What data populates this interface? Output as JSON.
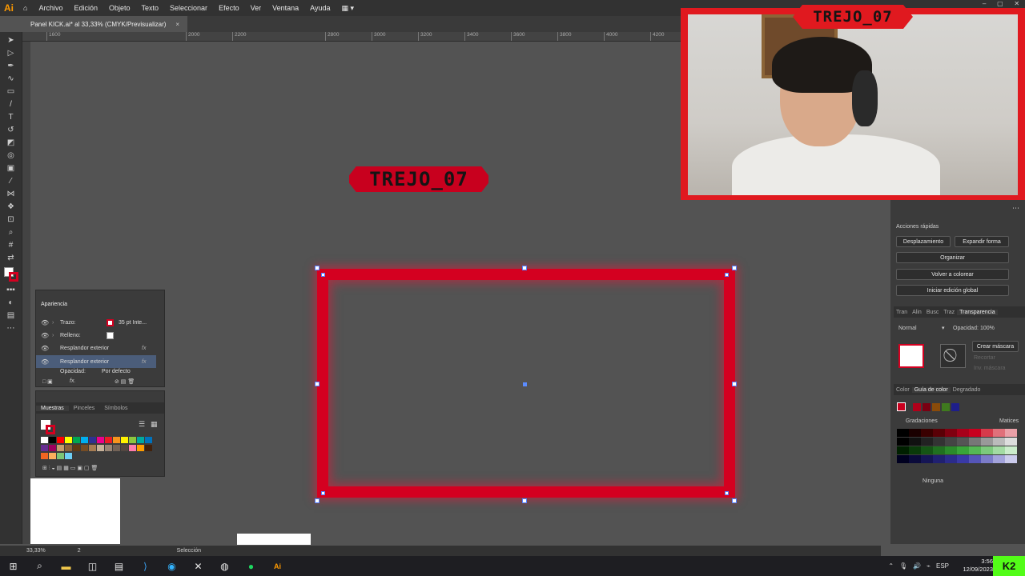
{
  "app": {
    "logo": "Ai",
    "brand_color": "#ff9a00"
  },
  "menu": [
    "Archivo",
    "Edición",
    "Objeto",
    "Texto",
    "Seleccionar",
    "Efecto",
    "Ver",
    "Ventana",
    "Ayuda"
  ],
  "doc_tab": {
    "title": "Panel KICK.ai* al 33,33% (CMYK/Previsualizar)",
    "close": "×"
  },
  "ruler_ticks": [
    "1600",
    "2000",
    "2200",
    "2400",
    "2800",
    "3000",
    "3200",
    "3400",
    "3600",
    "3800",
    "4000",
    "4200"
  ],
  "canvas": {
    "banner_text": "TREJO_07",
    "accent": "#d40020"
  },
  "webcam": {
    "title": "TREJO_07"
  },
  "right_panel": {
    "acciones_title": "Acciones rápidas",
    "btn_desplazamiento": "Desplazamiento",
    "btn_expandir": "Expandir forma",
    "btn_organizar": "Organizar",
    "btn_volver": "Volver a colorear",
    "btn_iniciar": "Iniciar edición global",
    "tabs1": [
      "Tran",
      "Alin",
      "Busc",
      "Traz",
      "Transparencia"
    ],
    "blend_mode": "Normal",
    "opacity_label": "Opacidad:",
    "opacity_value": "100%",
    "btn_crear_mascara": "Crear máscara",
    "chk_recortar": "Recortar",
    "chk_invertir": "Inv. máscara",
    "tabs2": [
      "Color",
      "Guía de color",
      "Degradado"
    ],
    "gradaciones": "Gradaciones",
    "matices": "Matices",
    "ninguna": "Ninguna"
  },
  "apariencia": {
    "title": "Apariencia",
    "rows": [
      {
        "label": "Trazo:",
        "value": "35 pt  Inte..."
      },
      {
        "label": "Relleno:",
        "value": ""
      },
      {
        "label": "Resplandor exterior",
        "value": "fx"
      },
      {
        "label": "Resplandor exterior",
        "value": "fx"
      },
      {
        "label": "Opacidad:",
        "value": "Por defecto"
      }
    ],
    "footer_fx": "fx."
  },
  "muestras": {
    "tabs": [
      "Muestras",
      "Pinceles",
      "Símbolos"
    ]
  },
  "statusbar": {
    "zoom": "33,33%",
    "artboard": "2",
    "tool": "Selección"
  },
  "taskbar": {
    "lang": "ESP",
    "time": "3:56",
    "date": "12/09/2023",
    "kick": "K2"
  }
}
